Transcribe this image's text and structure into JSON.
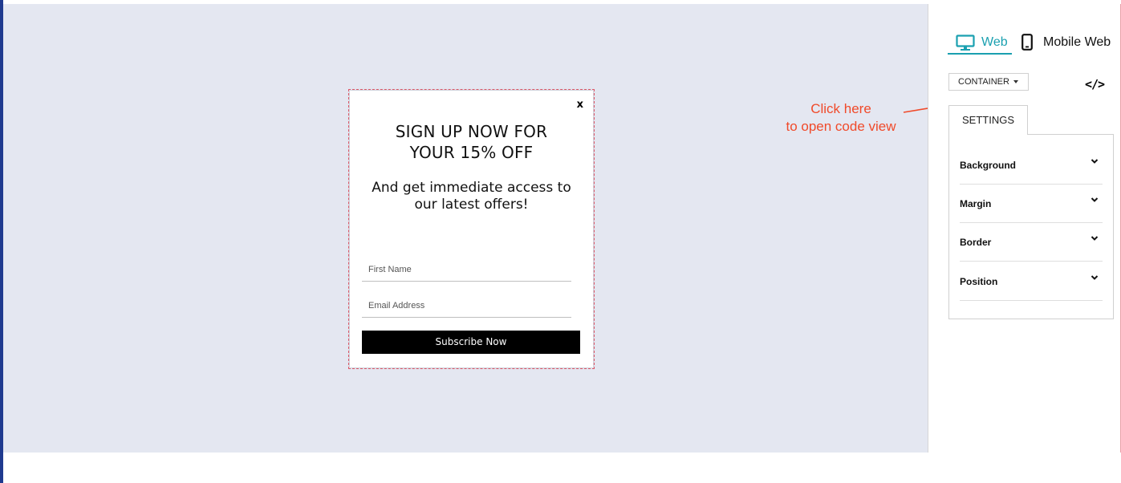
{
  "popup": {
    "close_label": "x",
    "headline_line1": "SIGN UP NOW FOR",
    "headline_line2": "YOUR 15% OFF",
    "subline_line1": "And get immediate access to",
    "subline_line2": "our latest offers!",
    "first_name_placeholder": "First Name",
    "email_placeholder": "Email Address",
    "subscribe_label": "Subscribe Now"
  },
  "annotation": {
    "line1": "Click here",
    "line2": "to open code view",
    "color": "#f04a2a"
  },
  "panel": {
    "tabs": [
      {
        "label": "Web",
        "icon": "monitor-icon",
        "active": true
      },
      {
        "label": "Mobile Web",
        "icon": "phone-icon",
        "active": false
      }
    ],
    "container_dropdown": "CONTAINER",
    "code_icon": "code-icon",
    "settings_tab": "SETTINGS",
    "settings_sections": [
      {
        "label": "Background"
      },
      {
        "label": "Margin"
      },
      {
        "label": "Border"
      },
      {
        "label": "Position"
      }
    ]
  },
  "colors": {
    "canvas_bg": "#e4e7f1",
    "accent": "#1aa0b0",
    "button_bg": "#000000"
  }
}
